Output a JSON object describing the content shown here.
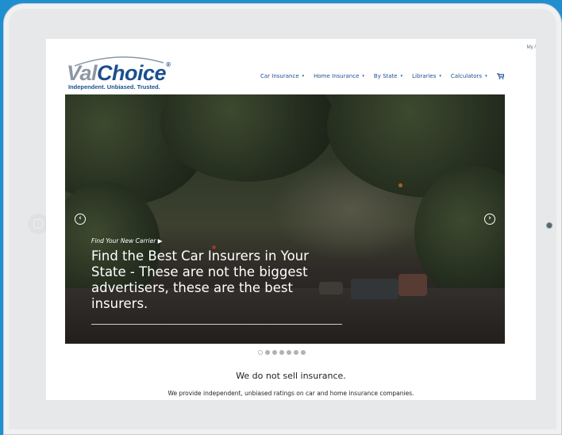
{
  "header": {
    "my_account": "My /",
    "logo": {
      "val": "Val",
      "choice": "Choice",
      "reg": "®",
      "tagline": "Independent. Unbiased. Trusted."
    },
    "nav": [
      {
        "label": "Car Insurance",
        "caret": "▾"
      },
      {
        "label": "Home Insurance",
        "caret": "▾"
      },
      {
        "label": "By State",
        "caret": "▾"
      },
      {
        "label": "Libraries",
        "caret": "▾"
      },
      {
        "label": "Calculators",
        "caret": "▾"
      }
    ],
    "cart_icon": "cart-icon"
  },
  "hero": {
    "kicker": "Find Your New Carrier ▶",
    "headline": "Find the Best Car Insurers in Your State - These are not the biggest advertisers, these are the best insurers.",
    "prev_arrow": "‹",
    "next_arrow": "›"
  },
  "slider": {
    "dots": 7,
    "active_index": 0
  },
  "content": {
    "tagline": "We do not sell insurance.",
    "subline": "We provide independent, unbiased ratings on car and home insurance companies."
  },
  "colors": {
    "background": "#1f8fd0",
    "brand_blue": "#1b4f8f",
    "logo_gray": "#8b98a3"
  }
}
